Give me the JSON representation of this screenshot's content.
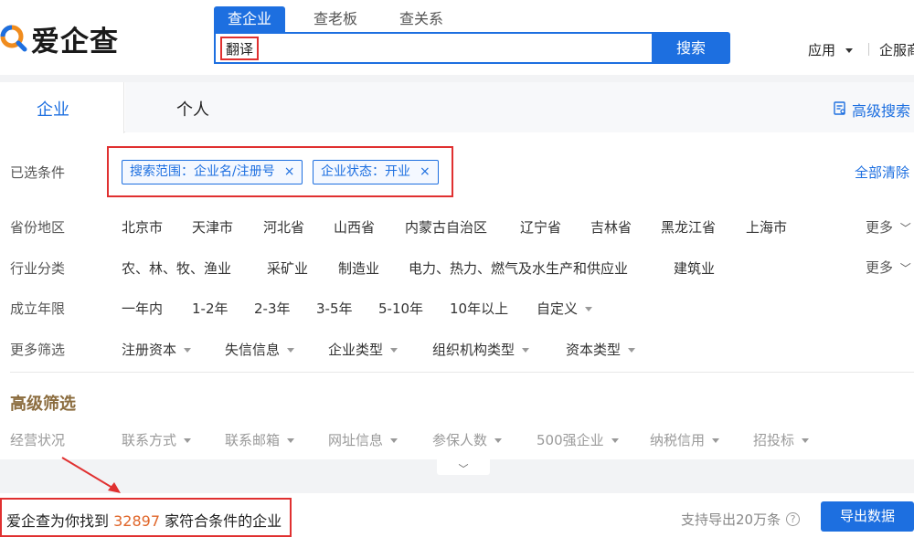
{
  "header": {
    "logo_text": "爱企查",
    "search_tabs": [
      "查企业",
      "查老板",
      "查关系"
    ],
    "search_value": "翻译",
    "search_button": "搜索",
    "app_menu": "应用",
    "qifu_link": "企服商"
  },
  "entity_tabs": {
    "company": "企业",
    "person": "个人",
    "advanced_search": "高级搜索"
  },
  "selected": {
    "label": "已选条件",
    "chips": [
      "搜索范围：企业名/注册号",
      "企业状态：开业"
    ],
    "clear_all": "全部清除"
  },
  "filters": {
    "region": {
      "label": "省份地区",
      "options": [
        "北京市",
        "天津市",
        "河北省",
        "山西省",
        "内蒙古自治区",
        "辽宁省",
        "吉林省",
        "黑龙江省",
        "上海市"
      ],
      "more": "更多"
    },
    "industry": {
      "label": "行业分类",
      "options": [
        "农、林、牧、渔业",
        "采矿业",
        "制造业",
        "电力、热力、燃气及水生产和供应业",
        "建筑业"
      ],
      "more": "更多"
    },
    "age": {
      "label": "成立年限",
      "options": [
        "一年内",
        "1-2年",
        "2-3年",
        "3-5年",
        "5-10年",
        "10年以上",
        "自定义"
      ]
    },
    "more_filters": {
      "label": "更多筛选",
      "options": [
        "注册资本",
        "失信信息",
        "企业类型",
        "组织机构类型",
        "资本类型"
      ]
    }
  },
  "advanced": {
    "title": "高级筛选",
    "label": "经营状况",
    "options": [
      "联系方式",
      "联系邮箱",
      "网址信息",
      "参保人数",
      "500强企业",
      "纳税信用",
      "招投标"
    ]
  },
  "result": {
    "prefix": "爱企查为你找到",
    "count": "32897",
    "suffix": "家符合条件的企业",
    "export_hint": "支持导出20万条",
    "export_button": "导出数据"
  },
  "colors": {
    "accent": "#1d6fe0",
    "highlight_border": "#e03030",
    "count_color": "#e0662a",
    "advanced_title": "#8b6c3e"
  }
}
